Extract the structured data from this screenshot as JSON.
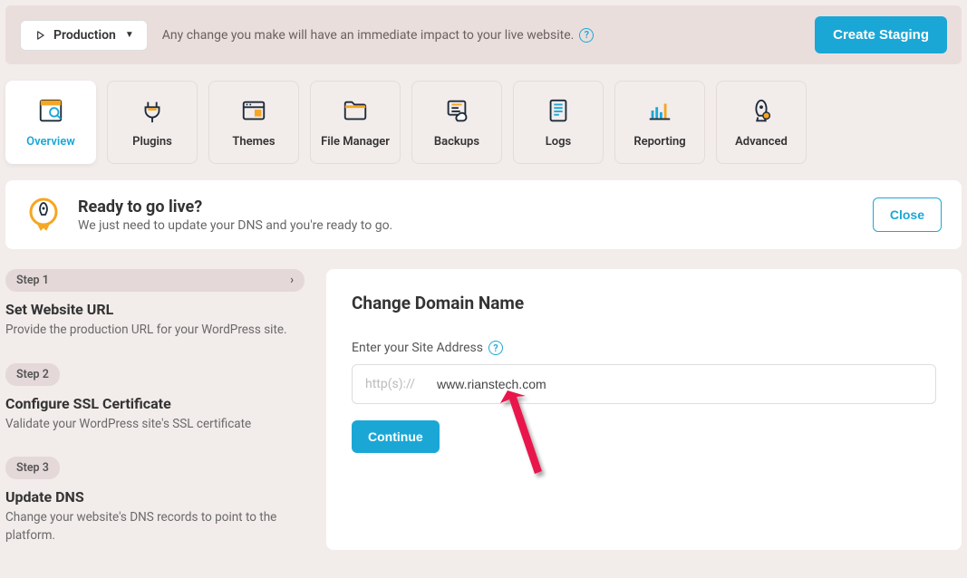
{
  "banner": {
    "env_label": "Production",
    "message": "Any change you make will have an immediate impact to your live website.",
    "staging_btn": "Create Staging"
  },
  "tabs": [
    {
      "label": "Overview"
    },
    {
      "label": "Plugins"
    },
    {
      "label": "Themes"
    },
    {
      "label": "File Manager"
    },
    {
      "label": "Backups"
    },
    {
      "label": "Logs"
    },
    {
      "label": "Reporting"
    },
    {
      "label": "Advanced"
    }
  ],
  "ready": {
    "title": "Ready to go live?",
    "subtitle": "We just need to update your DNS and you're ready to go.",
    "close": "Close"
  },
  "steps": [
    {
      "pill": "Step 1",
      "title": "Set Website URL",
      "desc": "Provide the production URL for your WordPress site."
    },
    {
      "pill": "Step 2",
      "title": "Configure SSL Certificate",
      "desc": "Validate your WordPress site's SSL certificate"
    },
    {
      "pill": "Step 3",
      "title": "Update DNS",
      "desc": "Change your website's DNS records to point to the platform."
    }
  ],
  "panel": {
    "heading": "Change Domain Name",
    "field_label": "Enter your Site Address",
    "prefix": "http(s)://",
    "value": "www.rianstech.com",
    "continue": "Continue"
  }
}
